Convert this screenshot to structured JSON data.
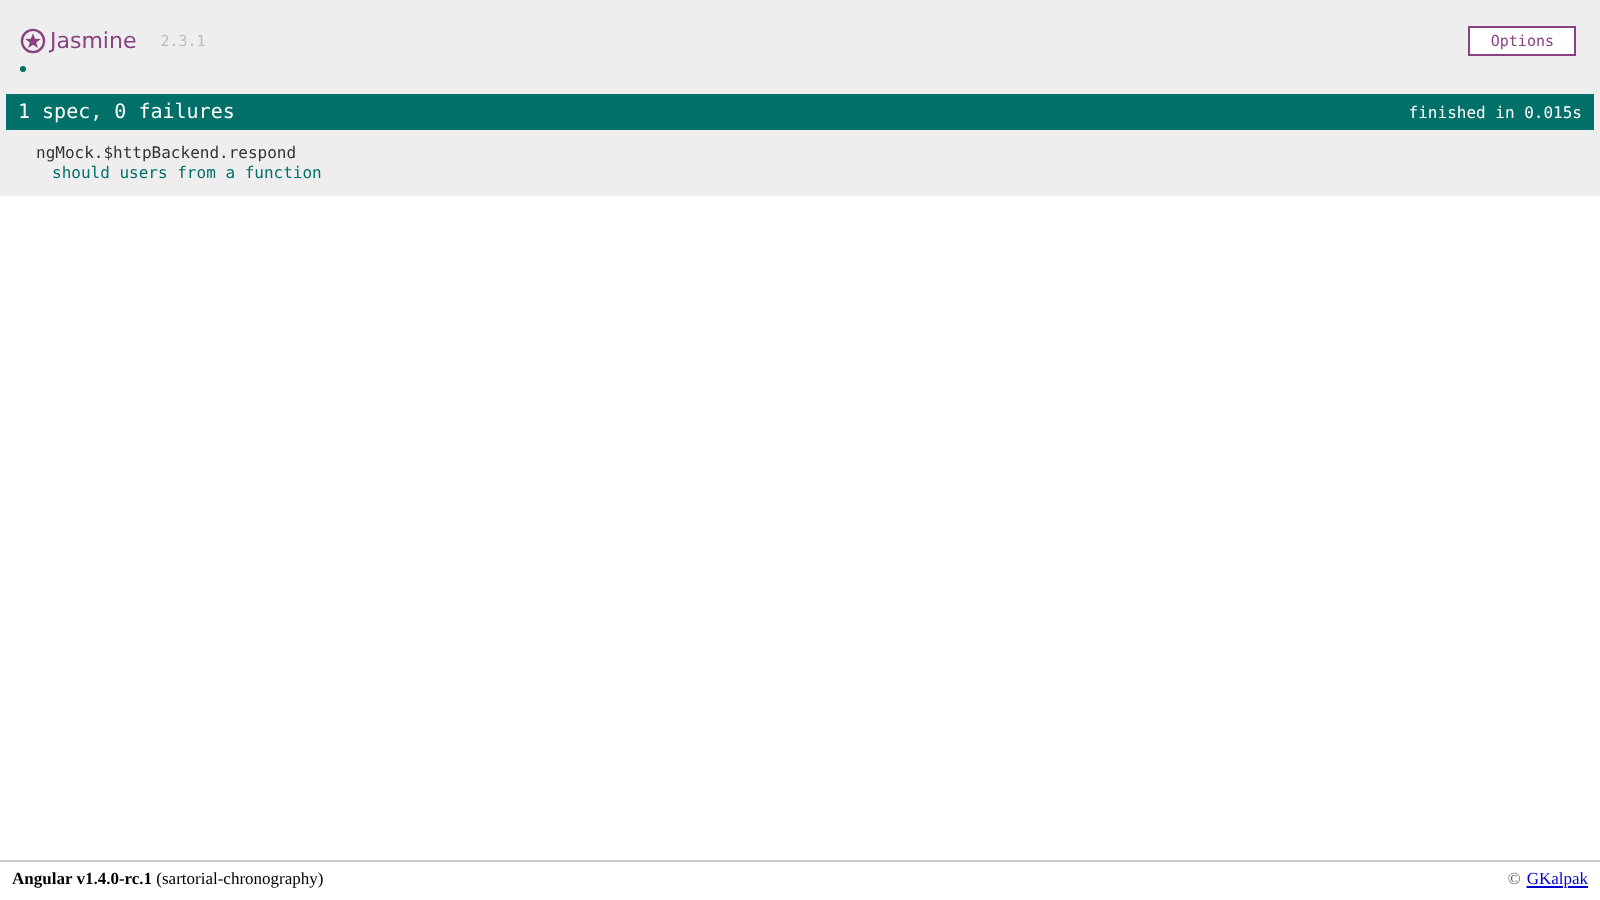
{
  "header": {
    "logo": "Jasmine",
    "version": "2.3.1",
    "options_button": "Options"
  },
  "symbol_summary": [
    {
      "kind": "passed"
    }
  ],
  "summary_bar": {
    "kind": "passed",
    "overall": "1 spec, 0 failures",
    "duration": "finished in 0.015s"
  },
  "suites": [
    {
      "name": "ngMock.$httpBackend.respond",
      "specs": [
        {
          "name": "should users from a function",
          "kind": "passed"
        }
      ]
    }
  ],
  "footer": {
    "title": "Angular v1.4.0-rc.1",
    "subtitle": "(sartorial-chronography)",
    "copyright": "©",
    "link": "GKalpak"
  }
}
